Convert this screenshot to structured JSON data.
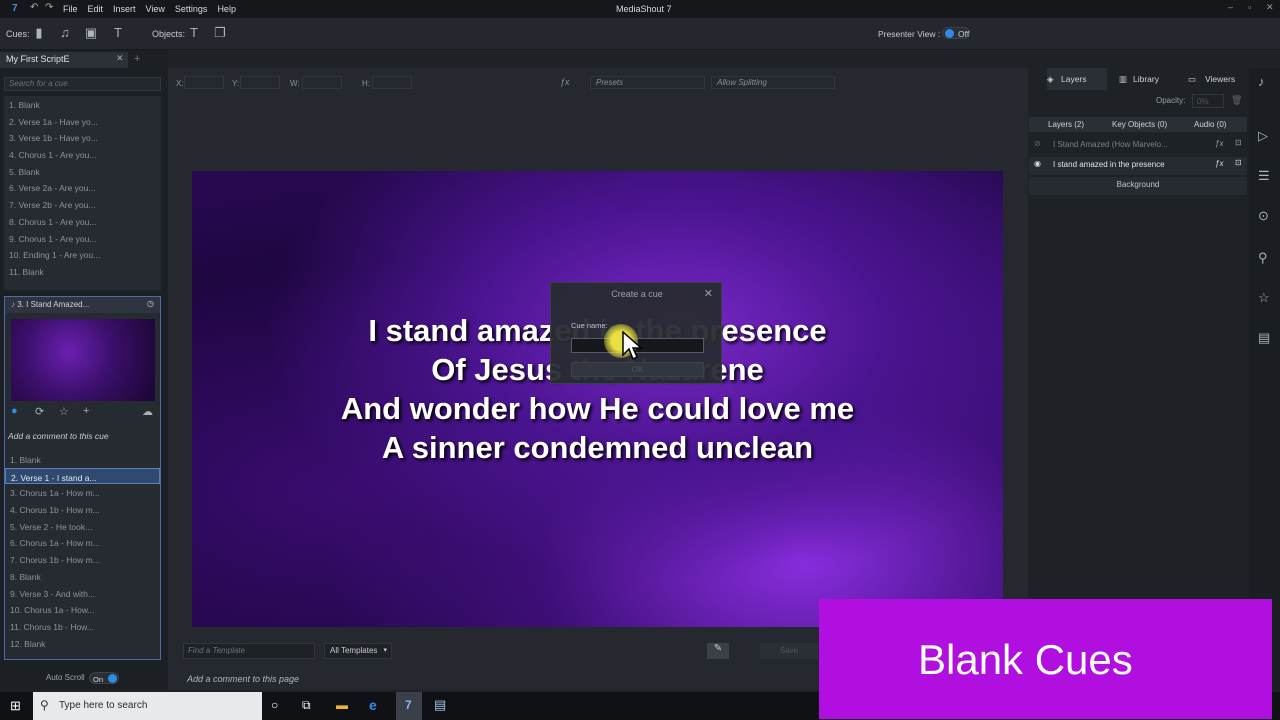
{
  "app": {
    "title": "MediaShout 7",
    "menu": [
      "File",
      "Edit",
      "Insert",
      "View",
      "Settings",
      "Help"
    ]
  },
  "toolbar": {
    "cues_label": "Cues:",
    "objects_label": "Objects:",
    "presenter_view_label": "Presenter View :",
    "presenter_view_state": "Off"
  },
  "script": {
    "tab_label": "My First ScriptE",
    "search_placeholder": "Search for a cue",
    "cues": [
      "1. Blank",
      "2. Verse 1a - Have yo...",
      "3. Verse 1b - Have yo...",
      "4. Chorus 1 - Are you...",
      "5. Blank",
      "6. Verse 2a - Are you...",
      "7. Verse 2b - Are you...",
      "8. Chorus 1 - Are you...",
      "9. Chorus 1 - Are you...",
      "10. Ending 1 - Are you...",
      "11. Blank"
    ]
  },
  "cue_card": {
    "title": "3.  I Stand Amazed...",
    "comment_placeholder": "Add a comment to this cue",
    "pages": [
      "1. Blank",
      "2. Verse 1 - I stand a...",
      "3. Chorus 1a - How m...",
      "4. Chorus 1b - How m...",
      "5. Verse 2 - He took...",
      "6. Chorus 1a - How m...",
      "7. Chorus 1b - How m...",
      "8. Blank",
      "9. Verse 3 - And with...",
      "10. Chorus 1a - How...",
      "11. Chorus 1b - How...",
      "12. Blank"
    ],
    "selected_index": 1
  },
  "auto_scroll": {
    "label": "Auto Scroll",
    "state": "On"
  },
  "propbar": {
    "x": "X:",
    "y": "Y:",
    "w": "W:",
    "h": "H:",
    "presets": "Presets",
    "splitting": "Allow Splitting"
  },
  "slide": {
    "lines": [
      "I stand amazed in the presence",
      "Of Jesus the Nazarene",
      "And wonder how He could love me",
      "A sinner condemned unclean"
    ]
  },
  "dialog": {
    "title": "Create a cue",
    "field_label": "Cue name:",
    "ok_label": "OK"
  },
  "templates": {
    "search_placeholder": "Find a Template",
    "filter": "All Templates",
    "save_label": "Save"
  },
  "page_comment_placeholder": "Add a comment to this page",
  "right": {
    "tabs": [
      "Layers",
      "Library",
      "Viewers"
    ],
    "opacity_label": "Opacity:",
    "opacity_value": "0%",
    "subtabs": [
      "Layers (2)",
      "Key Objects (0)",
      "Audio (0)"
    ],
    "layers": [
      "I Stand Amazed (How Marvelo...",
      "I stand amazed in the presence"
    ],
    "background_label": "Background"
  },
  "taskbar": {
    "search_placeholder": "Type here to search"
  },
  "banner": {
    "text": "Blank Cues",
    "color": "#b10fe0"
  },
  "colors": {
    "accent": "#2e8be6",
    "selection": "#2f4a6e"
  }
}
